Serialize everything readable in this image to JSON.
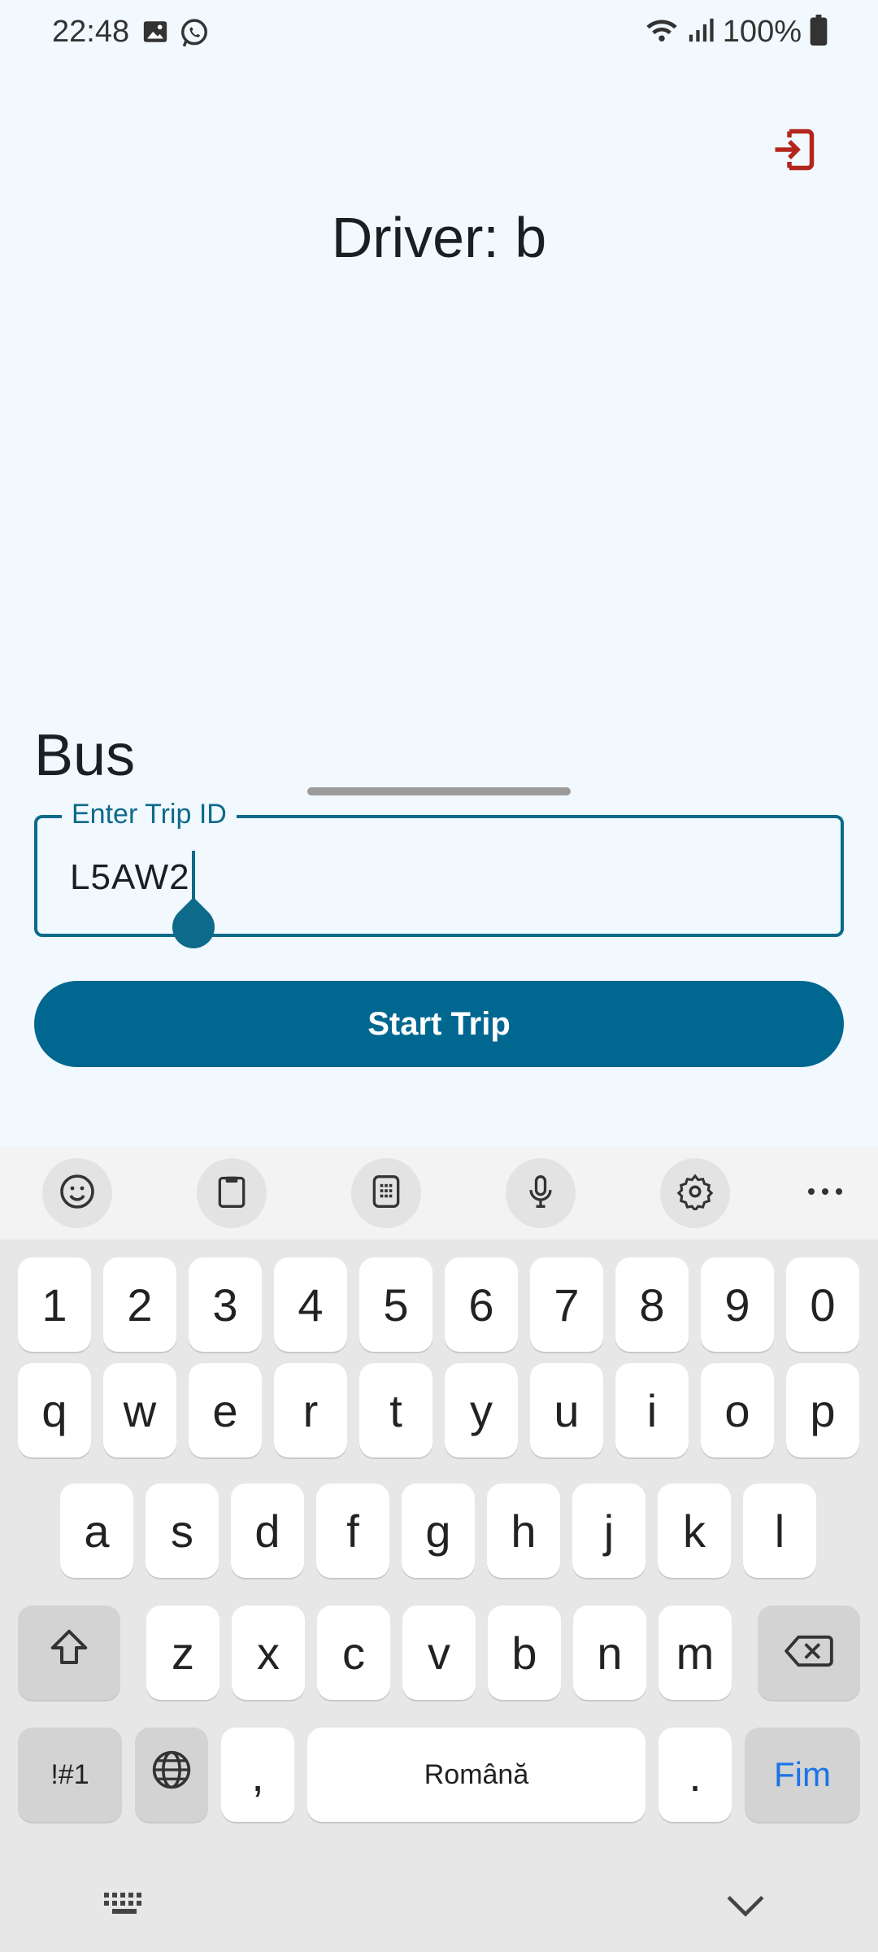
{
  "status_bar": {
    "time": "22:48",
    "battery_text": "100%",
    "icons": [
      "image-icon",
      "whatsapp-icon",
      "wifi-icon",
      "signal-icon",
      "battery-icon"
    ]
  },
  "app": {
    "driver_title": "Driver: b",
    "section_label": "Bus",
    "trip_field": {
      "label": "Enter Trip ID",
      "value": "L5AW2"
    },
    "start_button_label": "Start Trip",
    "logout_icon": "logout-icon",
    "accent_color": "#006790",
    "logout_color": "#B3261E"
  },
  "keyboard": {
    "toolbar_icons": [
      "emoji-icon",
      "clipboard-icon",
      "keypad-icon",
      "microphone-icon",
      "settings-icon",
      "more-icon"
    ],
    "number_row": [
      "1",
      "2",
      "3",
      "4",
      "5",
      "6",
      "7",
      "8",
      "9",
      "0"
    ],
    "row1": [
      "q",
      "w",
      "e",
      "r",
      "t",
      "y",
      "u",
      "i",
      "o",
      "p"
    ],
    "row2": [
      "a",
      "s",
      "d",
      "f",
      "g",
      "h",
      "j",
      "k",
      "l"
    ],
    "row3": [
      "z",
      "x",
      "c",
      "v",
      "b",
      "n",
      "m"
    ],
    "symbols_label": "!#1",
    "comma": ",",
    "space_label": "Română",
    "period": ".",
    "action_label": "Fim"
  }
}
